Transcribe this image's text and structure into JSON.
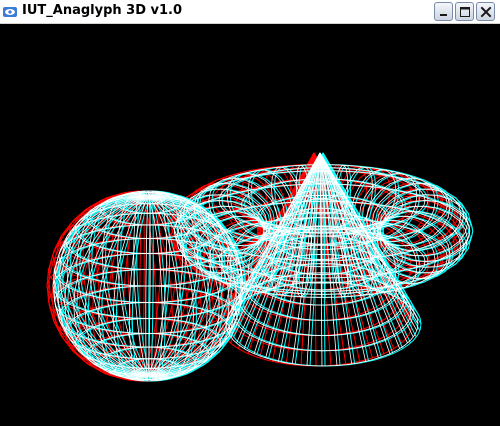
{
  "window": {
    "title": "IUT_Anaglyph 3D v1.0",
    "icon": "app-window-icon"
  },
  "controls": {
    "minimize_icon": "minimize-icon",
    "maximize_icon": "maximize-icon",
    "close_icon": "close-icon"
  },
  "scene": {
    "rendering": "red-cyan anaglyph wireframe",
    "objects": [
      "sphere",
      "torus",
      "cone"
    ],
    "background_color": "#000000",
    "left_eye_color": "#ff0000",
    "right_eye_color": "#00ffff",
    "overlap_color": "#ffffff"
  }
}
